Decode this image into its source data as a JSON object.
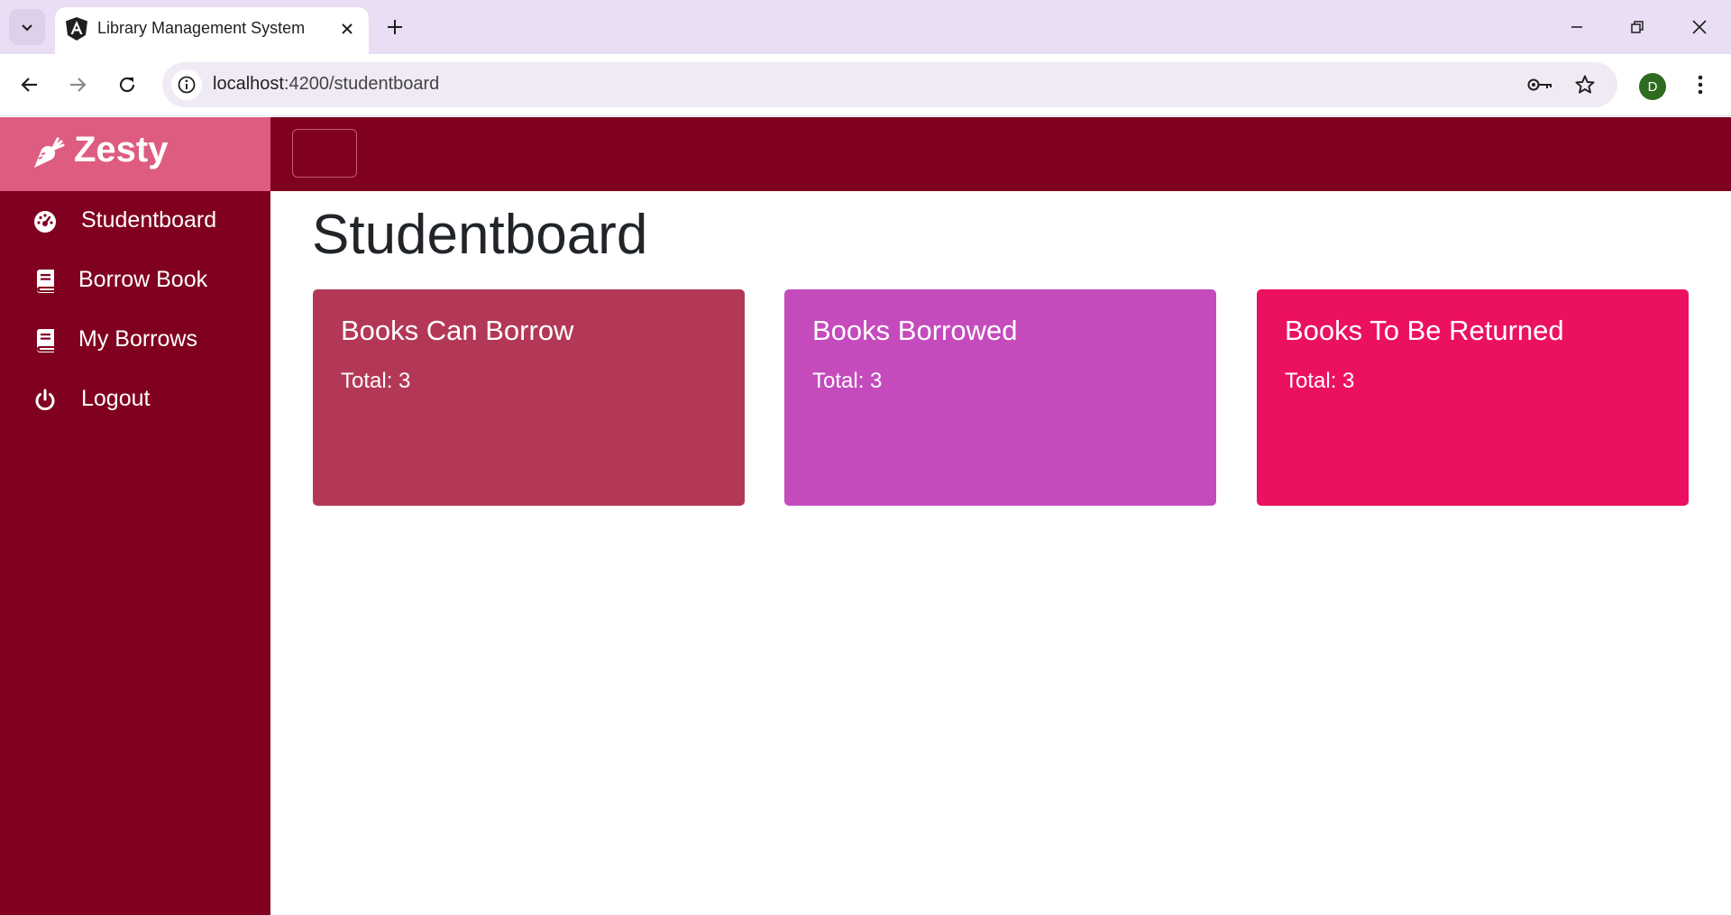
{
  "browser": {
    "tab_title": "Library Management System",
    "url_host": "localhost",
    "url_path": ":4200/studentboard",
    "profile_initial": "D"
  },
  "app": {
    "brand": "Zesty",
    "menu": [
      {
        "label": "Studentboard",
        "icon": "dashboard-icon"
      },
      {
        "label": "Borrow Book",
        "icon": "book-icon"
      },
      {
        "label": "My Borrows",
        "icon": "book-icon"
      },
      {
        "label": "Logout",
        "icon": "power-icon"
      }
    ],
    "page_title": "Studentboard",
    "cards": [
      {
        "title": "Books Can Borrow",
        "total": "Total: 3",
        "color": "#b33856"
      },
      {
        "title": "Books Borrowed",
        "total": "Total: 3",
        "color": "#c54bbd"
      },
      {
        "title": "Books To Be Returned",
        "total": "Total: 3",
        "color": "#ec1160"
      }
    ],
    "colors": {
      "sidebar": "#80001f",
      "brand_bg": "#de5c80",
      "topbar": "#80001f"
    }
  }
}
